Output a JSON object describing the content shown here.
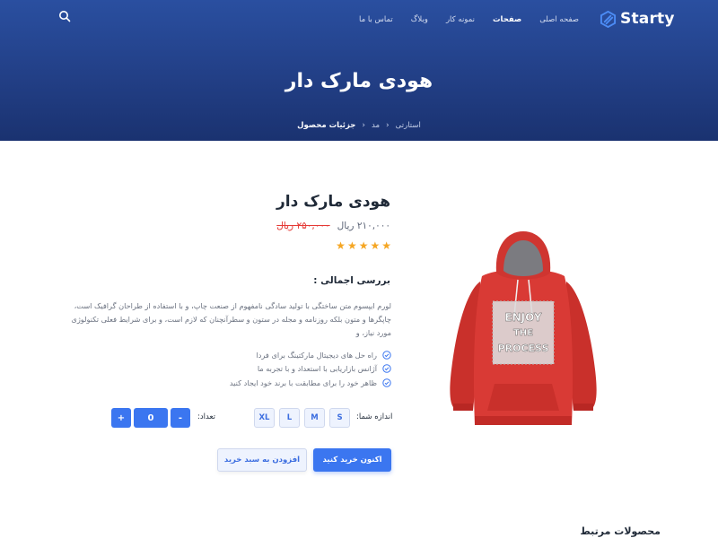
{
  "header": {
    "logo_text": "Starty",
    "nav": [
      "صفحه اصلی",
      "صفحات",
      "نمونه کار",
      "وبلاگ",
      "تماس با ما"
    ],
    "active_nav": "صفحات",
    "title": "هودی مارک دار",
    "breadcrumb": [
      "استارتی",
      "مد",
      "جزئیات محصول"
    ]
  },
  "product": {
    "title": "هودی مارک دار",
    "price": "۲۱۰,۰۰۰ ریال",
    "old_price": "۲۵۰,۰۰۰ ریال",
    "rating": 5,
    "rating_max": 5,
    "overview_heading": "بررسی اجمالی :",
    "description": "لورم ایپسوم متن ساختگی با تولید سادگی نامفهوم از صنعت چاپ، و با استفاده از طراحان گرافیک است، چاپگرها و متون بلکه روزنامه و مجله در ستون و سطرآنچنان که لازم است، و برای شرایط فعلی تکنولوژی مورد نیاز، و",
    "features": [
      "راه حل های دیجیتال مارکتینگ برای فردا",
      "آژانس بازاریابی با استعداد و با تجربه ما",
      "ظاهر خود را برای مطابقت با برند خود ایجاد کنید"
    ],
    "size_label": "اندازه شما:",
    "sizes": [
      "S",
      "M",
      "L",
      "XL"
    ],
    "quantity_label": "تعداد:",
    "quantity": "0",
    "minus": "-",
    "plus": "+",
    "buy_now_label": "اکنون خرید کنید",
    "add_to_cart_label": "افزودن به سبد خرید",
    "image_text": [
      "ENJOY",
      "THE",
      "PROCESS"
    ]
  },
  "related_heading": "محصولات مرتبط",
  "colors": {
    "hero_top": "#2a4fa0",
    "hero_bottom": "#1a3270",
    "accent": "#3b76f0",
    "star": "#f5a623",
    "old_price": "#e53935",
    "hoodie": "#d93a35"
  },
  "icons": {
    "logo": "logo-icon",
    "search": "search-icon",
    "breadcrumb_separator": "chevron-left-icon",
    "feature": "check-circle-icon",
    "star": "star-icon"
  }
}
